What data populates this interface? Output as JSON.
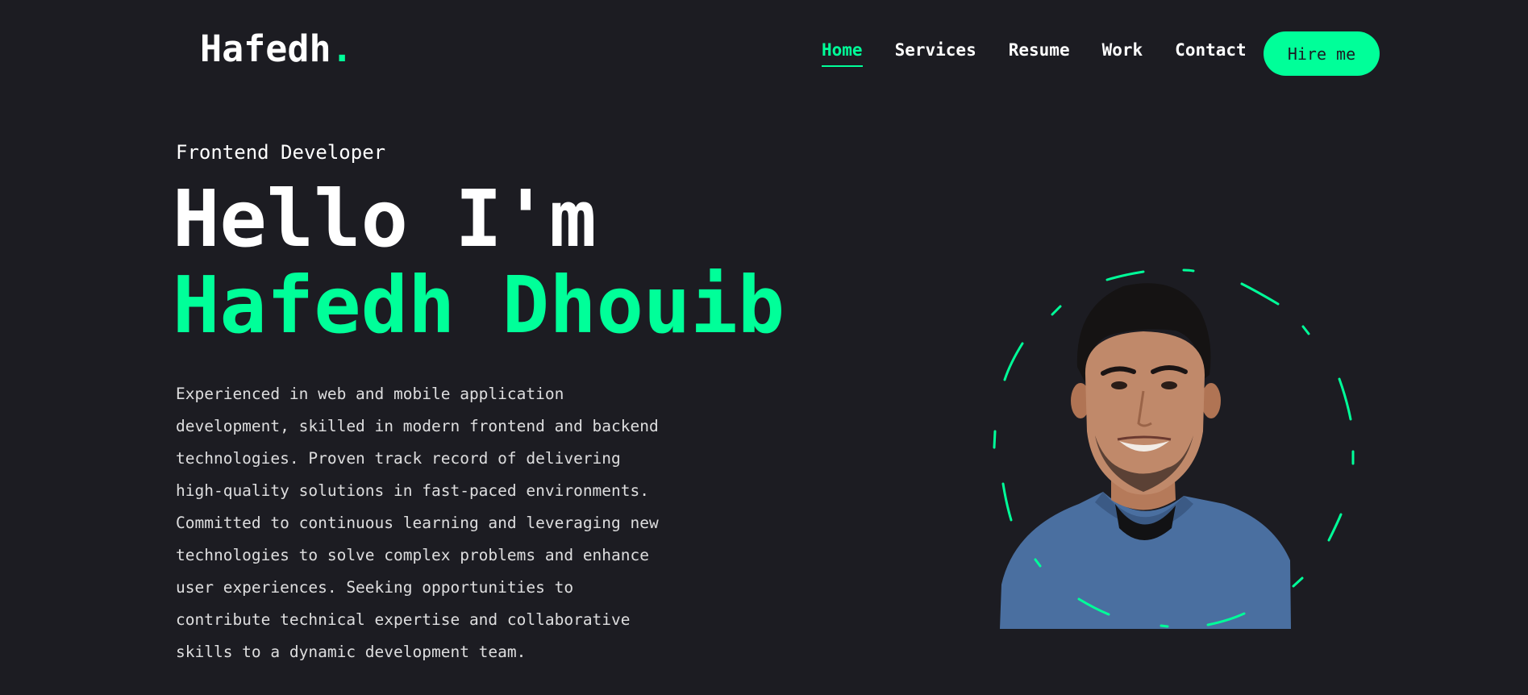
{
  "header": {
    "logo_text": "Hafedh",
    "logo_dot": ".",
    "nav": [
      {
        "label": "Home",
        "active": true
      },
      {
        "label": "Services",
        "active": false
      },
      {
        "label": "Resume",
        "active": false
      },
      {
        "label": "Work",
        "active": false
      },
      {
        "label": "Contact",
        "active": false
      }
    ],
    "hire_label": "Hire me"
  },
  "hero": {
    "role": "Frontend Developer",
    "greeting": "Hello I'm",
    "name": "Hafedh Dhouib",
    "bio_lines": [
      "Experienced in web and mobile application",
      "development, skilled in modern frontend and backend",
      "technologies. Proven track record of delivering",
      "high-quality solutions in fast-paced environments.",
      "Committed to continuous learning and leveraging new",
      "technologies to solve complex problems and enhance",
      "user experiences. Seeking opportunities to",
      "contribute technical expertise and collaborative",
      "skills to a dynamic development team."
    ]
  },
  "colors": {
    "background": "#1c1c22",
    "accent": "#00ff99",
    "text": "#ffffff"
  }
}
